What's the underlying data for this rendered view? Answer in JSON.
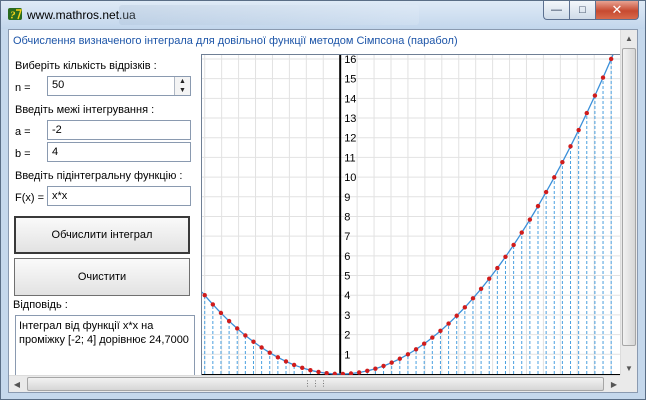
{
  "window": {
    "title": "www.mathros.net.ua",
    "heading": "Обчислення визначеного інтеграла для довільної функції методом Сімпсона (парабол)"
  },
  "form": {
    "segments_label": "Виберіть кількість відрізків :",
    "n_label": "n  =",
    "n_value": "50",
    "limits_label": "Введіть межі інтегрування :",
    "a_label": "a  =",
    "a_value": "-2",
    "b_label": "b  =",
    "b_value": "4",
    "function_label": "Введіть підінтегральну функцію :",
    "fx_label": "F(x)  =",
    "fx_value": "x*x",
    "compute_button": "Обчислити інтеграл",
    "clear_button": "Очистити",
    "answer_label": "Відповідь :",
    "answer_text": "Інтеграл від функції x*x на проміжку [-2; 4] дорівнює 24,7000"
  },
  "chart_data": {
    "type": "line",
    "function": "x*x",
    "a": -2,
    "b": 4,
    "n": 50,
    "x_visible_range": [
      -2.04,
      4.16
    ],
    "y_visible_range": [
      0,
      16.2
    ],
    "y_tick_labels": [
      "1",
      "2",
      "3",
      "4",
      "5",
      "6",
      "7",
      "8",
      "9",
      "10",
      "11",
      "12",
      "13",
      "14",
      "15",
      "16"
    ],
    "grid": true,
    "colors": {
      "curve": "#3a8fd9",
      "nodes": "#d01c1c",
      "fill_lines": "#4aa0e0",
      "axis": "#000000",
      "grid": "#e2e2e2"
    }
  }
}
